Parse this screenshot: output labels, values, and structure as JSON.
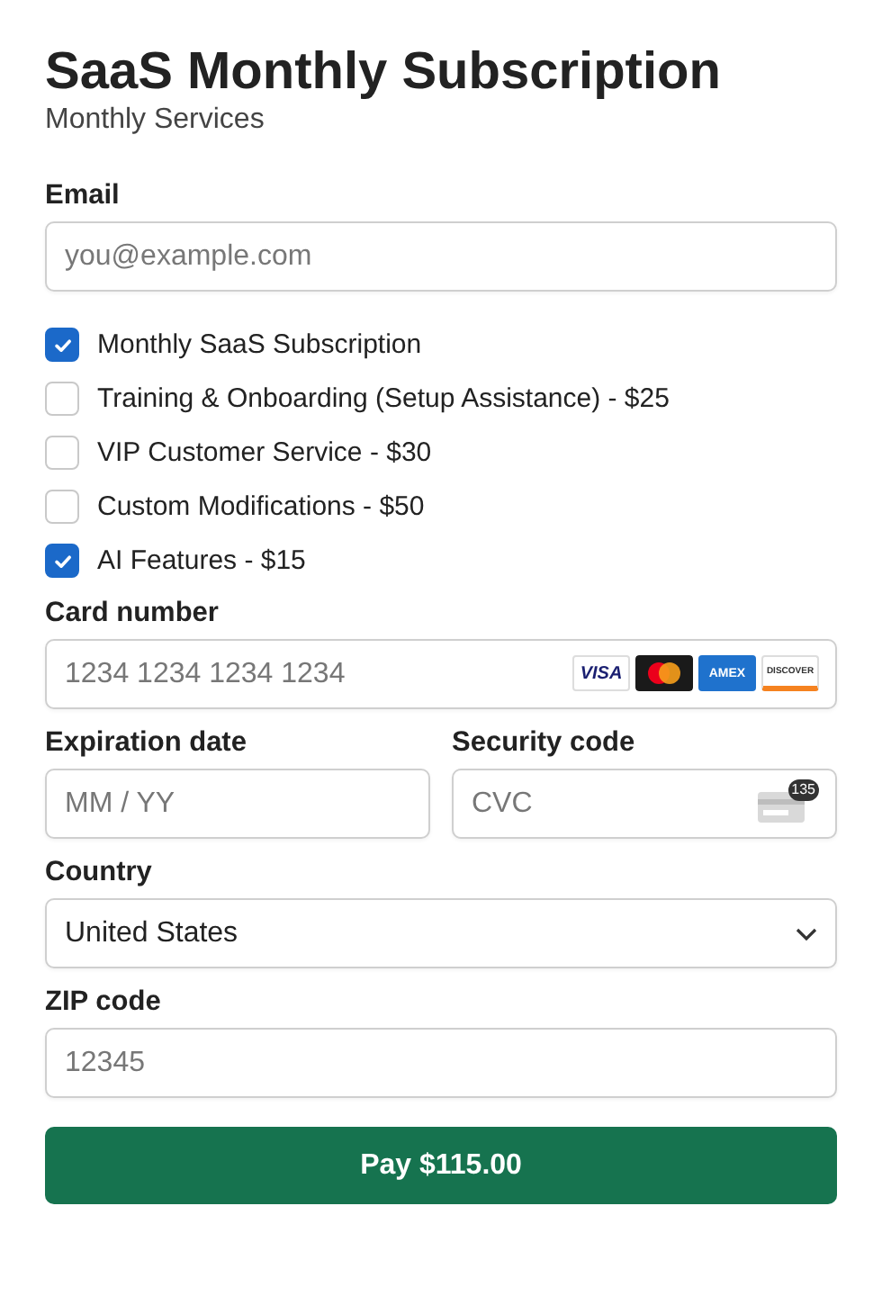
{
  "header": {
    "title": "SaaS Monthly Subscription",
    "subtitle": "Monthly Services"
  },
  "email": {
    "label": "Email",
    "placeholder": "you@example.com"
  },
  "options": [
    {
      "label": "Monthly SaaS Subscription",
      "checked": true
    },
    {
      "label": "Training & Onboarding (Setup Assistance) - $25",
      "checked": false
    },
    {
      "label": "VIP Customer Service - $30",
      "checked": false
    },
    {
      "label": "Custom Modifications - $50",
      "checked": false
    },
    {
      "label": "AI Features - $15",
      "checked": true
    }
  ],
  "card_number": {
    "label": "Card number",
    "placeholder": "1234 1234 1234 1234",
    "brands": [
      {
        "kind": "visa",
        "label": "VISA"
      },
      {
        "kind": "mastercard"
      },
      {
        "kind": "amex",
        "label": "AMEX"
      },
      {
        "kind": "discover",
        "label": "DISCOVER"
      }
    ]
  },
  "expiration": {
    "label": "Expiration date",
    "placeholder": "MM / YY"
  },
  "security_code": {
    "label": "Security code",
    "placeholder": "CVC",
    "hint": "135"
  },
  "country": {
    "label": "Country",
    "value": "United States"
  },
  "zip": {
    "label": "ZIP code",
    "placeholder": "12345"
  },
  "pay_button": "Pay $115.00"
}
